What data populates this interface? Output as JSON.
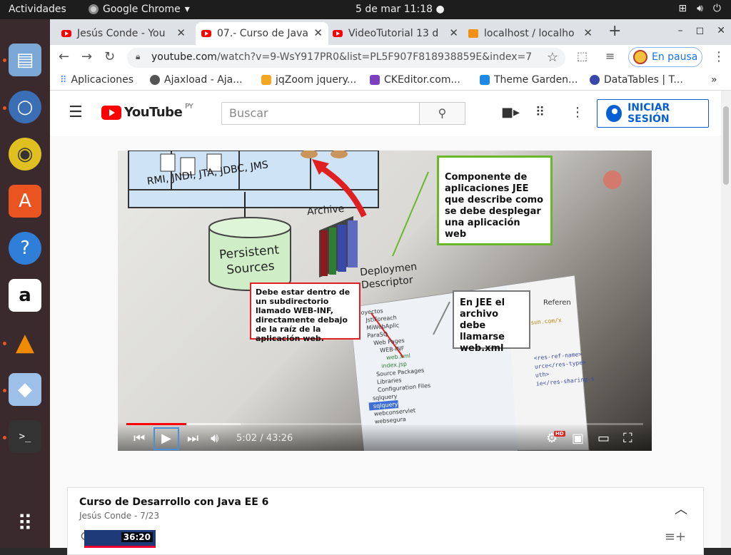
{
  "topbar": {
    "activities": "Actividades",
    "app_name": "Google Chrome",
    "clock": "5 de mar  11:18 ●",
    "sys_icons": [
      "network-icon",
      "volume-icon",
      "power-icon"
    ]
  },
  "dock": {
    "items": [
      "files-icon",
      "chromium-icon",
      "rhythmbox-icon",
      "software-icon",
      "help-icon",
      "amazon-icon",
      "vlc-icon",
      "virtualbox-icon",
      "terminal-icon"
    ],
    "apps_grid": "apps-grid-icon"
  },
  "tabs": [
    {
      "label": "Jesús Conde - You",
      "active": false
    },
    {
      "label": "07.- Curso de Java",
      "active": true
    },
    {
      "label": "VideoTutorial 13 d",
      "active": false
    },
    {
      "label": "localhost / localho",
      "active": false
    }
  ],
  "new_tab": "+",
  "window_controls": [
    "–",
    "◻",
    "✕"
  ],
  "address": {
    "url_host": "youtube.com",
    "url_path": "/watch?v=9-WsY917PR0&list=PL5F907F818938859E&index=7"
  },
  "profile": {
    "label": "En pausa"
  },
  "bookmarks": [
    {
      "label": "Aplicaciones",
      "color": "#4285f4"
    },
    {
      "label": "Ajaxload - Aja...",
      "color": "#555555"
    },
    {
      "label": "jqZoom jquery...",
      "color": "#f5a623"
    },
    {
      "label": "CKEditor.com...",
      "color": "#7b3fbf"
    },
    {
      "label": "Theme Garden...",
      "color": "#1e88e5"
    },
    {
      "label": "DataTables | T...",
      "color": "#3949ab"
    }
  ],
  "bookmarks_more": "»",
  "youtube": {
    "logo_text": "YouTube",
    "region": "PY",
    "search_placeholder": "Buscar",
    "signin_label": "INICIAR SESIÓN"
  },
  "video": {
    "slide": {
      "rmi": "RMI, JNDI, JTA, JDBC, JMS",
      "persistent": "Persistent Sources",
      "archive": "Archive",
      "deployment": "Deploymen Descriptor",
      "box1": "Componente de aplicaciones JEE que describe como se debe desplegar una aplicación web",
      "box2": "Debe estar dentro de un subdirectorio llamado WEB-INF, directamente debajo de la raíz de la aplicación web.",
      "box3": "En JEE el archivo debe llamarse web.xml",
      "referen": "Referen",
      "tree": [
        "oyectos",
        "JstlForeach",
        "MiWebAplic",
        "ParaSQ",
        "Web Pages",
        "WEB-INF",
        "web.xml",
        "index.jsp",
        "Source Packages",
        "Libraries",
        "Configuration Files",
        "sqlquery",
        "sqlquery",
        "webconservlet",
        "websegura"
      ],
      "code": [
        "sun.com/x",
        "<res-ref-name>",
        "urce</res-type>",
        "uth>",
        "ie</res-sharing-s"
      ]
    },
    "time": "5:02 / 43:26",
    "progress_fraction": 0.116
  },
  "playlist": {
    "title": "Curso de Desarrollo con Java EE 6",
    "subtitle": "Jesús Conde - 7/23",
    "thumb_duration": "36:20"
  }
}
